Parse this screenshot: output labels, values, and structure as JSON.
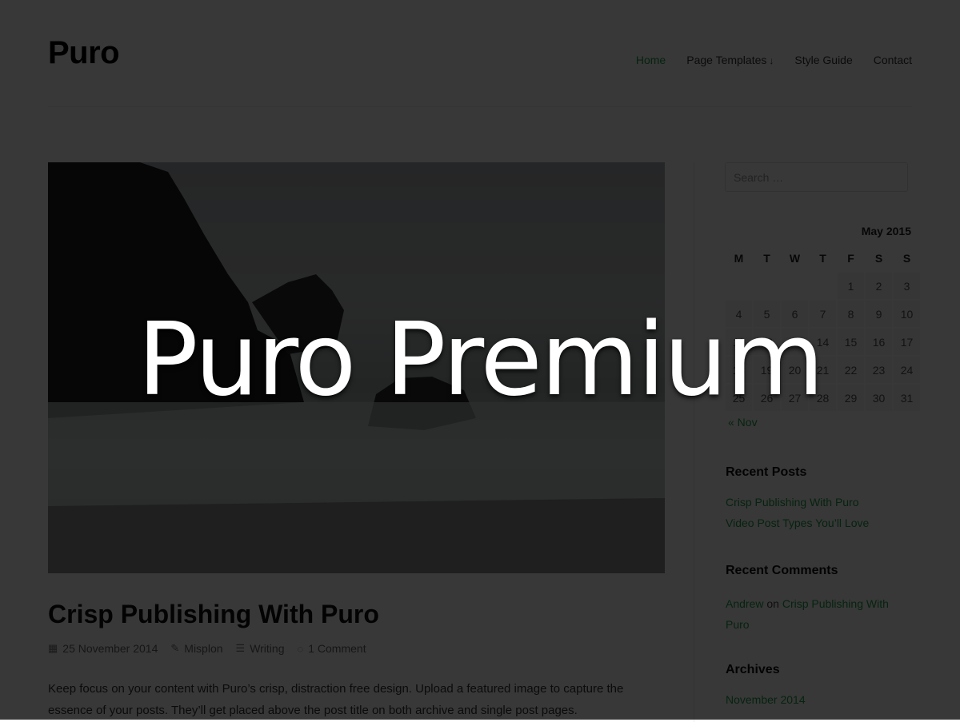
{
  "site": {
    "title": "Puro"
  },
  "nav": {
    "items": [
      {
        "label": "Home",
        "active": true
      },
      {
        "label": "Page Templates",
        "has_dropdown": true
      },
      {
        "label": "Style Guide"
      },
      {
        "label": "Contact"
      }
    ]
  },
  "post": {
    "title": "Crisp Publishing With Puro",
    "meta": {
      "date": "25 November 2014",
      "author": "Misplon",
      "category": "Writing",
      "comments": "1 Comment"
    },
    "excerpt": "Keep focus on your content with Puro’s crisp, distraction free design. Upload a featured image to capture the essence of your posts. They’ll get placed above the post title on both archive and single post pages."
  },
  "sidebar": {
    "search": {
      "placeholder": "Search …"
    },
    "calendar": {
      "caption": "May 2015",
      "weekdays": [
        "M",
        "T",
        "W",
        "T",
        "F",
        "S",
        "S"
      ],
      "weeks": [
        [
          "",
          "",
          "",
          "",
          "1",
          "2",
          "3"
        ],
        [
          "4",
          "5",
          "6",
          "7",
          "8",
          "9",
          "10"
        ],
        [
          "11",
          "12",
          "13",
          "14",
          "15",
          "16",
          "17"
        ],
        [
          "18",
          "19",
          "20",
          "21",
          "22",
          "23",
          "24"
        ],
        [
          "25",
          "26",
          "27",
          "28",
          "29",
          "30",
          "31"
        ]
      ],
      "prev_link": "« Nov"
    },
    "recent_posts": {
      "title": "Recent Posts",
      "items": [
        "Crisp Publishing With Puro",
        "Video Post Types You’ll Love"
      ]
    },
    "recent_comments": {
      "title": "Recent Comments",
      "author": "Andrew",
      "connector": "on",
      "post": "Crisp Publishing With Puro"
    },
    "archives": {
      "title": "Archives",
      "items": [
        "November 2014"
      ]
    }
  },
  "banner": {
    "text": "Puro Premium"
  },
  "colors": {
    "accent": "#1e9e4a",
    "overlay": "#000000"
  }
}
